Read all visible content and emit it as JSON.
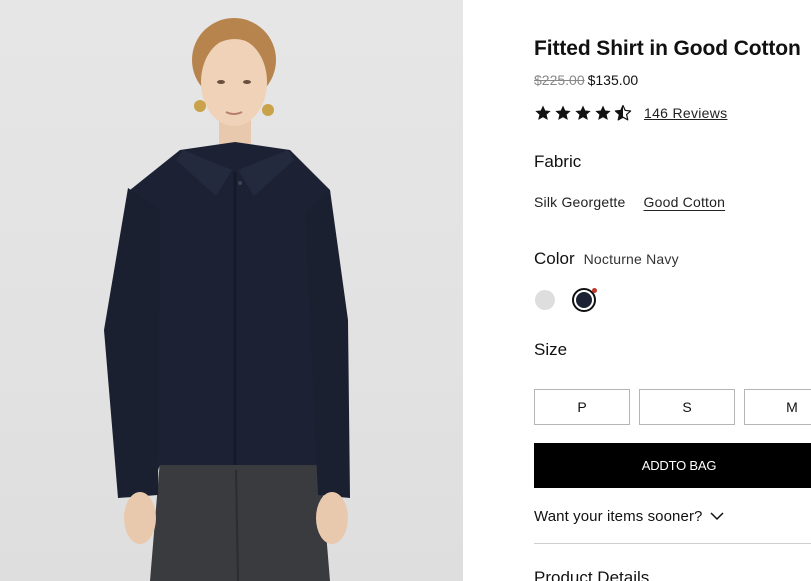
{
  "product": {
    "title": "Fitted Shirt in Good Cotton",
    "price_original": "$225.00",
    "price_sale": "$135.00",
    "rating": 4.5,
    "rating_max": 5,
    "reviews_label": "146 Reviews"
  },
  "fabric": {
    "label": "Fabric",
    "options": [
      "Silk Georgette",
      "Good Cotton"
    ],
    "selected": "Good Cotton"
  },
  "color": {
    "label": "Color",
    "selected_name": "Nocturne Navy",
    "swatches": [
      {
        "name": "white",
        "hex": "#dedede"
      },
      {
        "name": "Nocturne Navy",
        "hex": "#1c2233"
      }
    ]
  },
  "size": {
    "label": "Size",
    "options": [
      "P",
      "S",
      "M"
    ]
  },
  "actions": {
    "add_to_bag": "ADDTO BAG",
    "want_sooner": "Want your items sooner?"
  },
  "sections": {
    "product_details": "Product Details"
  },
  "colors": {
    "button_bg": "#000000",
    "sale_dot": "#c0392b",
    "shirt": "#1c2233"
  },
  "icons": {
    "star": "star-icon",
    "star_half": "star-half-icon",
    "chevron": "chevron-down-icon"
  }
}
